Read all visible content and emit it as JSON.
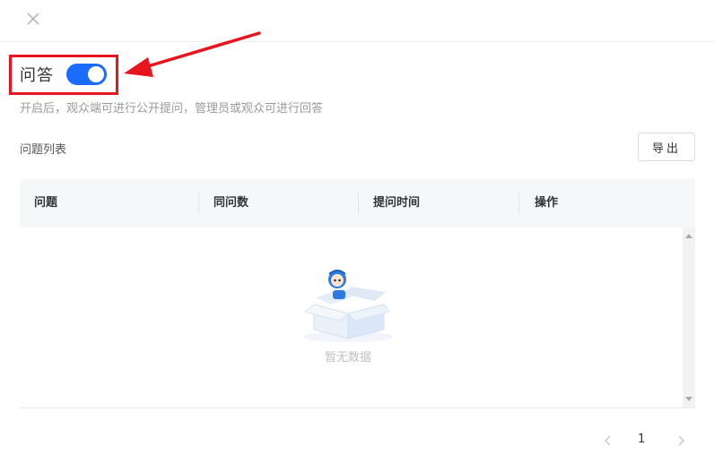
{
  "header": {
    "close_icon": "close-icon"
  },
  "qa": {
    "title": "问答",
    "enabled": true,
    "toggle_color": "#1a6cff",
    "hint": "开启后，观众端可进行公开提问，管理员或观众可进行回答"
  },
  "annotation": {
    "color": "#e8141e"
  },
  "list": {
    "title": "问题列表",
    "export_label": "导出"
  },
  "table": {
    "columns": [
      "问题",
      "同问数",
      "提问时间",
      "操作"
    ],
    "rows": [],
    "empty_text": "暂无数据"
  },
  "pagination": {
    "current_page": "1",
    "prev_icon": "chevron-left-icon",
    "next_icon": "chevron-right-icon"
  }
}
